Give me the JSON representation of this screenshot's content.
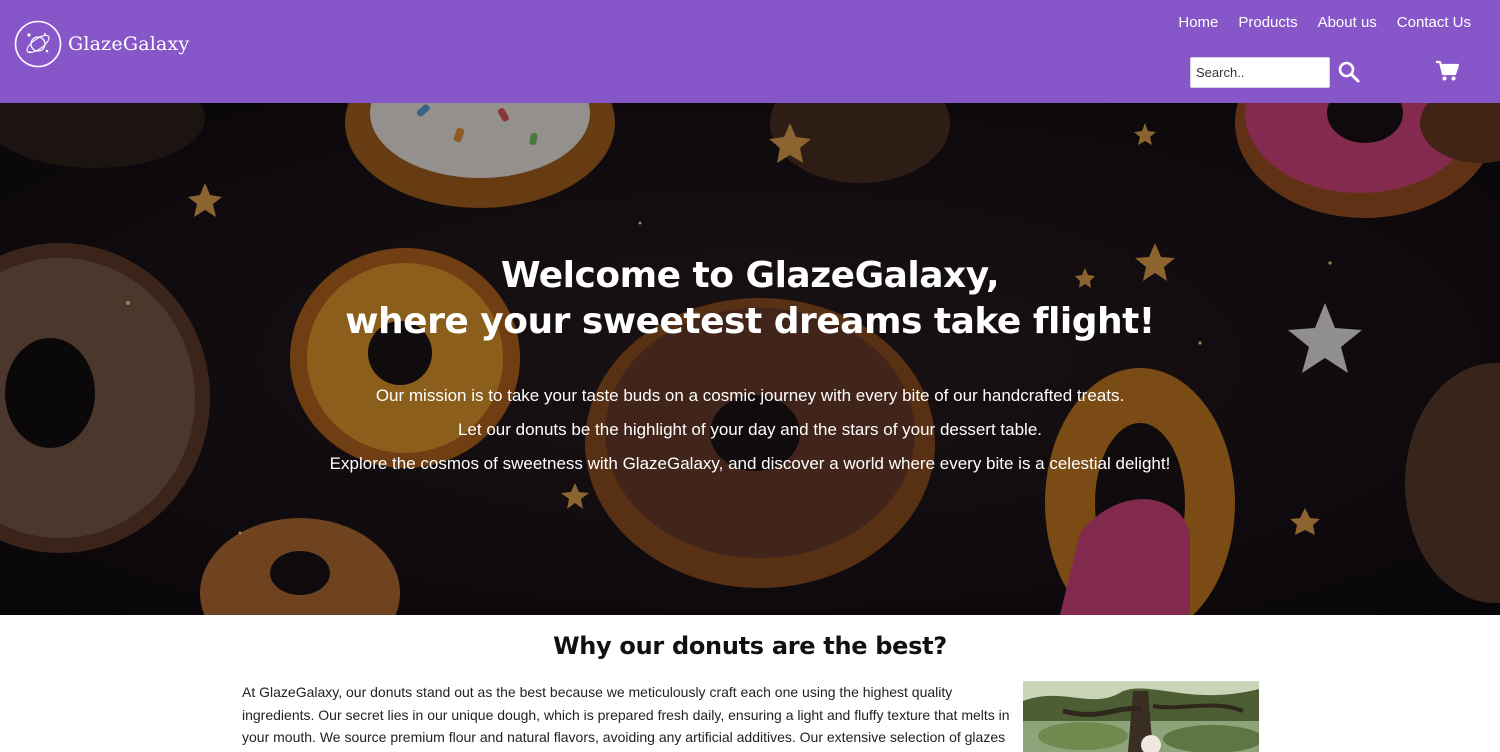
{
  "brand": {
    "name": "GlazeGalaxy",
    "logo_icon": "planet-orbit-icon"
  },
  "nav": {
    "items": [
      {
        "label": "Home"
      },
      {
        "label": "Products"
      },
      {
        "label": "About us"
      },
      {
        "label": "Contact Us"
      }
    ]
  },
  "search": {
    "placeholder": "Search..",
    "value": "",
    "button_icon": "search-icon"
  },
  "cart": {
    "icon": "cart-icon"
  },
  "hero": {
    "title_line1": "Welcome to GlazeGalaxy,",
    "title_line2": "where your sweetest dreams take flight!",
    "paragraphs": [
      "Our mission is to take your taste buds on a cosmic journey with every bite of our handcrafted treats.",
      "Let our donuts be the highlight of your day and the stars of your dessert table.",
      "Explore the cosmos of sweetness with GlazeGalaxy, and discover a world where every bite is a celestial delight!"
    ]
  },
  "why": {
    "title": "Why our donuts are the best?",
    "text_lines": [
      "At GlazeGalaxy, our donuts stand out as the best because we meticulously craft each one using the highest quality",
      "ingredients. Our secret lies in our unique dough, which is prepared fresh daily, ensuring a light and fluffy texture that melts in",
      "your mouth. We source premium flour and natural flavors, avoiding any artificial additives. Our extensive selection of glazes"
    ]
  },
  "colors": {
    "header_bg": "#8757c9",
    "hero_bg": "#17121a",
    "text_light": "#ffffff",
    "text_dark": "#111111"
  }
}
